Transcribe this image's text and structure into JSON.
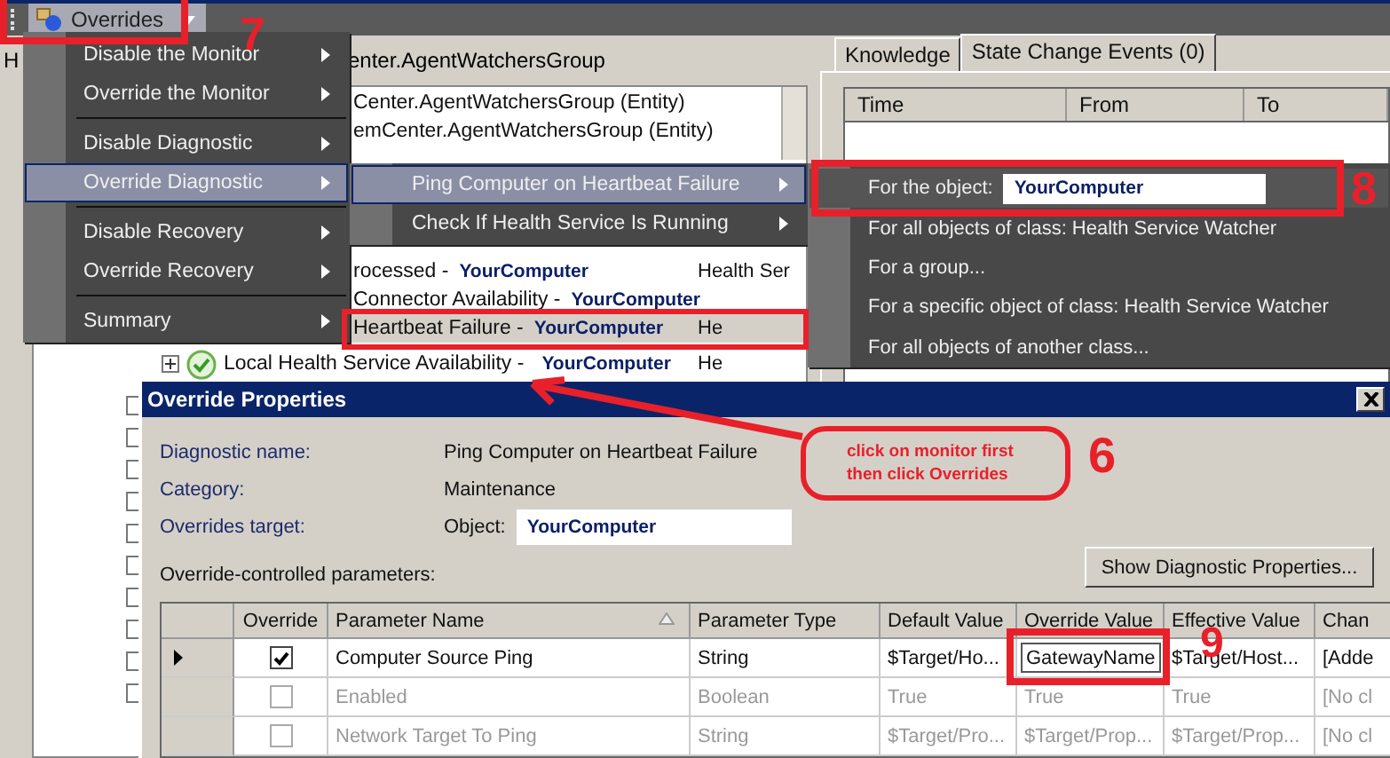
{
  "toolbar": {
    "overrides_button": {
      "label": "Overrides"
    }
  },
  "tree": {
    "heading_left": "H",
    "heading": "enter.AgentWatchersGroup",
    "upper_rows": [
      {
        "text": "Center.AgentWatchersGroup (Entity)",
        "selected": false
      },
      {
        "text": "emCenter.AgentWatchersGroup (Entity)",
        "selected": false
      }
    ],
    "lower_rows": [
      {
        "kind": "partial",
        "text": "rocessed -",
        "target": "YourComputer",
        "column_2": "Health Ser",
        "selected": false
      },
      {
        "kind": "partial",
        "text": "Connector Availability -",
        "target": "YourComputer",
        "selected": false
      },
      {
        "kind": "partial",
        "text": "Heartbeat Failure -",
        "target": "YourComputer",
        "column_2": "He",
        "selected": true
      },
      {
        "kind": "full",
        "text": "Local Health Service Availability -",
        "target": "YourComputer",
        "column_2": "He",
        "selected": false
      }
    ]
  },
  "details": {
    "tabs": [
      {
        "label": "Knowledge",
        "selected": false
      },
      {
        "label": "State Change Events (0)",
        "selected": true
      }
    ],
    "columns": [
      "Time",
      "From",
      "To"
    ]
  },
  "menu": {
    "items": [
      {
        "kind": "item",
        "label": "Disable the Monitor",
        "selected": false
      },
      {
        "kind": "item",
        "label": "Override the Monitor",
        "selected": false
      },
      {
        "kind": "separator"
      },
      {
        "kind": "item",
        "label": "Disable Diagnostic",
        "selected": false
      },
      {
        "kind": "item",
        "label": "Override Diagnostic",
        "selected": true
      },
      {
        "kind": "separator"
      },
      {
        "kind": "item",
        "label": "Disable Recovery",
        "selected": false
      },
      {
        "kind": "item",
        "label": "Override Recovery",
        "selected": false
      },
      {
        "kind": "separator"
      },
      {
        "kind": "item",
        "label": "Summary",
        "selected": false
      }
    ]
  },
  "submenu": {
    "items": [
      {
        "label": "Ping Computer on Heartbeat Failure",
        "selected": true
      },
      {
        "label": "Check If Health Service Is Running",
        "selected": false
      }
    ]
  },
  "target_menu": {
    "items": [
      {
        "kind": "field",
        "label": "For the object:",
        "value": "YourComputer",
        "selected": true
      },
      {
        "kind": "item",
        "label": "For all objects of class: Health Service Watcher",
        "selected": false
      },
      {
        "kind": "item",
        "label": "For a group...",
        "selected": false
      },
      {
        "kind": "item",
        "label": "For a specific object of class: Health Service Watcher",
        "selected": false
      },
      {
        "kind": "item",
        "label": "For all objects of another class...",
        "selected": false
      }
    ]
  },
  "dialog": {
    "title": "Override Properties",
    "fields": [
      {
        "label": "Diagnostic name:",
        "value": "Ping Computer on Heartbeat Failure"
      },
      {
        "label": "Category:",
        "value": "Maintenance"
      },
      {
        "label": "Overrides target:",
        "value": "Object:",
        "field_value": "YourComputer"
      }
    ],
    "parameters_label": "Override-controlled parameters:",
    "show_button": "Show Diagnostic Properties...",
    "table": {
      "columns": [
        "Override",
        "Parameter Name",
        "Parameter Type",
        "Default Value",
        "Override Value",
        "Effective Value",
        "Chan"
      ],
      "rows": [
        {
          "current": true,
          "checked": true,
          "enabled": true,
          "editing": true,
          "cells": [
            "",
            "Computer Source Ping",
            "String",
            "$Target/Ho...",
            "GatewayName",
            "$Target/Host...",
            "[Adde"
          ]
        },
        {
          "current": false,
          "checked": false,
          "enabled": false,
          "editing": false,
          "cells": [
            "",
            "Enabled",
            "Boolean",
            "True",
            "True",
            "True",
            "[No cl"
          ]
        },
        {
          "current": false,
          "checked": false,
          "enabled": false,
          "editing": false,
          "cells": [
            "",
            "Network Target To Ping",
            "String",
            "$Target/Pro...",
            "$Target/Prop...",
            "$Target/Prop...",
            "[No cl"
          ]
        }
      ]
    }
  },
  "annotations": {
    "callout": [
      "click on monitor first",
      "then click Overrides"
    ],
    "step_numbers": [
      "7",
      "8",
      "6",
      "9"
    ]
  }
}
